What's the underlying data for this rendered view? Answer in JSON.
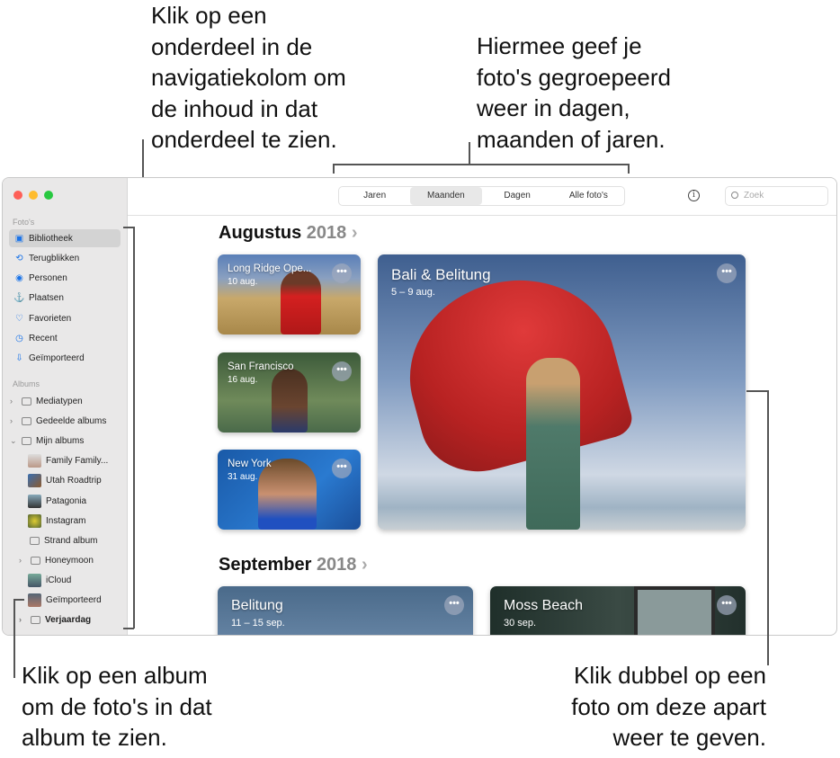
{
  "annotations": {
    "top_left": "Klik op een\nonderdeel in de\nnavigatiekolom om\nde inhoud in dat\nonderdeel te zien.",
    "top_right": "Hiermee geef je\nfoto's gegroepeerd\nweer in dagen,\nmaanden of jaren.",
    "bottom_left": "Klik op een album\nom de foto's in dat\nalbum te zien.",
    "bottom_right": "Klik dubbel op een\nfoto om deze apart\nweer te geven."
  },
  "sidebar": {
    "photos_header": "Foto's",
    "photos": [
      {
        "label": "Bibliotheek",
        "icon": "library-icon",
        "selected": true
      },
      {
        "label": "Terugblikken",
        "icon": "memories-icon"
      },
      {
        "label": "Personen",
        "icon": "people-icon"
      },
      {
        "label": "Plaatsen",
        "icon": "places-icon"
      },
      {
        "label": "Favorieten",
        "icon": "heart-icon"
      },
      {
        "label": "Recent",
        "icon": "clock-icon"
      },
      {
        "label": "Geïmporteerd",
        "icon": "import-icon"
      }
    ],
    "albums_header": "Albums",
    "albums": [
      {
        "label": "Mediatypen"
      },
      {
        "label": "Gedeelde albums"
      },
      {
        "label": "Mijn albums"
      }
    ],
    "my_albums": [
      {
        "label": "Family Family..."
      },
      {
        "label": "Utah Roadtrip"
      },
      {
        "label": "Patagonia"
      },
      {
        "label": "Instagram"
      },
      {
        "label": "Strand album"
      },
      {
        "label": "Honeymoon"
      },
      {
        "label": "iCloud"
      },
      {
        "label": "Geïmporteerd"
      },
      {
        "label": "Verjaardag"
      }
    ]
  },
  "toolbar": {
    "tabs": [
      "Jaren",
      "Maanden",
      "Dagen",
      "Alle foto's"
    ],
    "selected": "Maanden",
    "search_placeholder": "Zoek"
  },
  "months": [
    {
      "month": "Augustus",
      "year": "2018",
      "cards": [
        {
          "title": "Long Ridge Ope...",
          "date": "10 aug."
        },
        {
          "title": "San Francisco",
          "date": "16 aug."
        },
        {
          "title": "New York",
          "date": "31 aug."
        },
        {
          "title": "Bali & Belitung",
          "date": "5 – 9 aug."
        }
      ]
    },
    {
      "month": "September",
      "year": "2018",
      "cards": [
        {
          "title": "Belitung",
          "date": "11 – 15 sep."
        },
        {
          "title": "Moss Beach",
          "date": "30 sep."
        }
      ]
    }
  ],
  "more_glyph": "•••"
}
